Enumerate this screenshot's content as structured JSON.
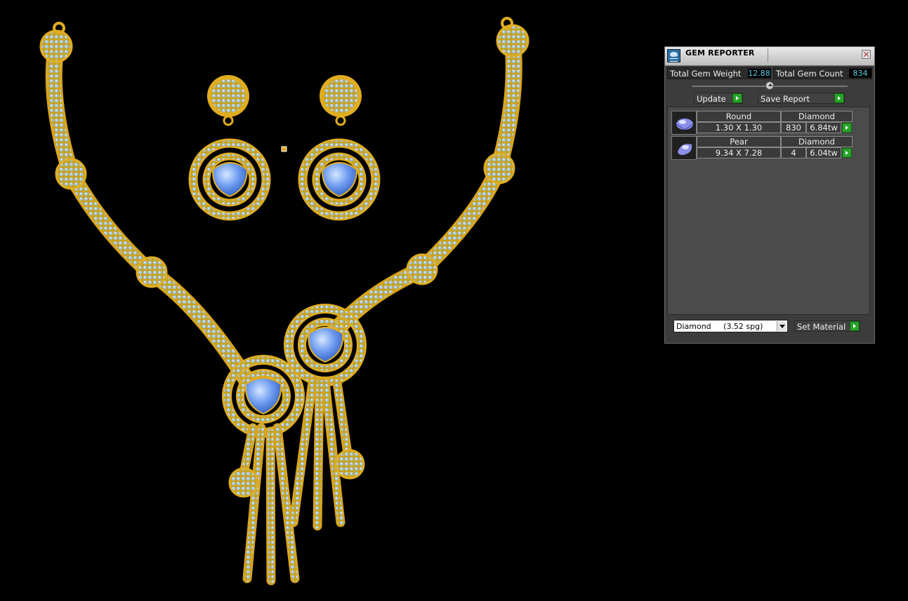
{
  "viewport": {
    "scene": "3D jewelry model: diamond necklace with pear-cut sapphire centers and matching earrings"
  },
  "gem_reporter": {
    "title": "GEM REPORTER",
    "icons": {
      "app": "gem-reporter-icon",
      "close": "close-icon"
    },
    "total_weight_label": "Total Gem Weight",
    "total_weight_value": "12.88",
    "total_count_label": "Total Gem Count",
    "total_count_value": "834",
    "update_label": "Update",
    "save_report_label": "Save Report",
    "rows": [
      {
        "shape": "Round",
        "size": "1.30 X 1.30",
        "material": "Diamond",
        "count": "830",
        "weight": "6.84tw",
        "icon": "round-gem-icon"
      },
      {
        "shape": "Pear",
        "size": "9.34 X 7.28",
        "material": "Diamond",
        "count": "4",
        "weight": "6.04tw",
        "icon": "pear-gem-icon"
      }
    ],
    "material_select": "Diamond     (3.52 spg)",
    "set_material_label": "Set Material",
    "colors": {
      "accent_green": "#29a329",
      "value_text": "#58d0e8",
      "panel_bg": "#3c3c3c"
    }
  }
}
